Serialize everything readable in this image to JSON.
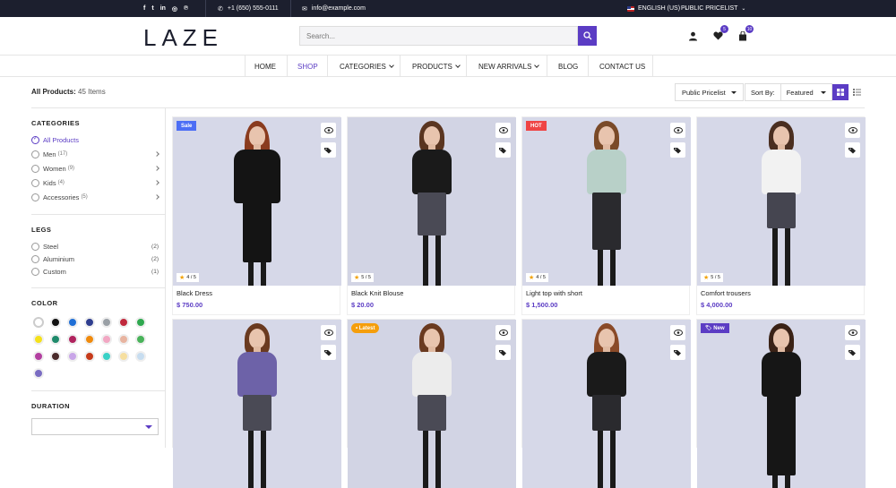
{
  "topbar": {
    "social_icons": [
      "facebook-icon",
      "twitter-icon",
      "linkedin-icon",
      "instagram-icon",
      "pinterest-icon"
    ],
    "phone": "+1 (650) 555-0111",
    "email": "info@example.com",
    "language": "ENGLISH (US)",
    "pricelist": "PUBLIC PRICELIST"
  },
  "header": {
    "logo": "LAZE",
    "search_placeholder": "Search...",
    "wishlist_count": "5",
    "cart_count": "10"
  },
  "nav": {
    "items": [
      "HOME",
      "SHOP",
      "CATEGORIES",
      "PRODUCTS",
      "NEW ARRIVALS",
      "BLOG",
      "CONTACT US"
    ],
    "active": "SHOP"
  },
  "toolbar": {
    "all_products_label": "All Products:",
    "count": "45 Items",
    "pricelist": "Public Pricelist",
    "sort_label": "Sort By:",
    "sort_value": "Featured"
  },
  "sidebar": {
    "categories_title": "CATEGORIES",
    "categories": [
      {
        "label": "All Products",
        "count": ""
      },
      {
        "label": "Men",
        "count": "(17)"
      },
      {
        "label": "Women",
        "count": "(9)"
      },
      {
        "label": "Kids",
        "count": "(4)"
      },
      {
        "label": "Accessories",
        "count": "(5)"
      }
    ],
    "legs_title": "LEGS",
    "legs": [
      {
        "label": "Steel",
        "count": "(2)"
      },
      {
        "label": "Aluminium",
        "count": "(2)"
      },
      {
        "label": "Custom",
        "count": "(1)"
      }
    ],
    "color_title": "COLOR",
    "colors": [
      "#ffffff",
      "#111111",
      "#1f6fd6",
      "#2f3e8f",
      "#9aa0a6",
      "#c0283c",
      "#2fa84f",
      "#f5e11a",
      "#1f8a6b",
      "#b0235e",
      "#f08a0c",
      "#f2a7c3",
      "#e8b4a0",
      "#49b35a",
      "#b23fa0",
      "#4a2a2a",
      "#c9a6e8",
      "#c63a1a",
      "#3ad1c6",
      "#f6dfa0",
      "#c7ddf0",
      "#7a6cc2"
    ],
    "duration_title": "DURATION"
  },
  "products": [
    {
      "name": "Black Dress",
      "price": "$ 750.00",
      "rating": "4 / 5",
      "tag": "Sale"
    },
    {
      "name": "Black Knit Blouse",
      "price": "$ 20.00",
      "rating": "5 / 5",
      "tag": ""
    },
    {
      "name": "Light top with short",
      "price": "$ 1,500.00",
      "rating": "4 / 5",
      "tag": "HOT"
    },
    {
      "name": "Comfort trousers",
      "price": "$ 4,000.00",
      "rating": "5 / 5",
      "tag": ""
    },
    {
      "name": "",
      "price": "",
      "rating": "",
      "tag": ""
    },
    {
      "name": "",
      "price": "",
      "rating": "",
      "tag": "Latest"
    },
    {
      "name": "",
      "price": "",
      "rating": "",
      "tag": ""
    },
    {
      "name": "",
      "price": "",
      "rating": "",
      "tag": "New"
    }
  ],
  "colors": {
    "accent": "#5b3cc4",
    "topbar": "#1c1f2e"
  }
}
